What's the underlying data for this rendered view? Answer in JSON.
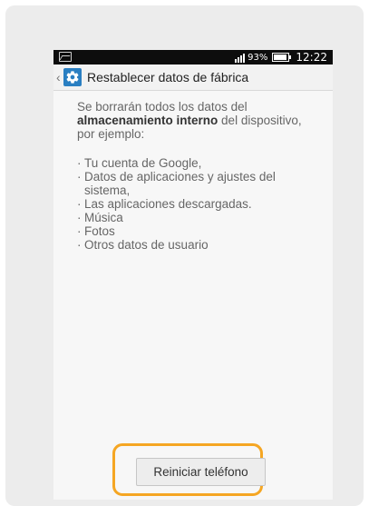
{
  "status_bar": {
    "signal_label": "ᴴ",
    "battery_percent_text": "93%",
    "battery_level": 0.93,
    "time": "12:22"
  },
  "app_bar": {
    "back_glyph": "‹",
    "title": "Restablecer datos de fábrica"
  },
  "content": {
    "intro_before": "Se borrarán todos los datos del ",
    "intro_bold": "almacenamiento interno",
    "intro_after": " del dispositivo, por ejemplo:",
    "items": [
      "Tu cuenta de Google,",
      "Datos de aplicaciones y ajustes del sistema,",
      "Las aplicaciones descargadas.",
      "Música",
      "Fotos",
      "Otros datos de usuario"
    ]
  },
  "actions": {
    "reset_label": "Reiniciar teléfono"
  },
  "colors": {
    "accent": "#2a7fc2",
    "highlight": "#f5a623",
    "status_bar_bg": "#0d0d0d"
  },
  "icons": {
    "status_left": "image-icon",
    "signal": "signal-icon",
    "battery": "battery-icon",
    "back": "chevron-left-icon",
    "app": "gear-icon"
  }
}
